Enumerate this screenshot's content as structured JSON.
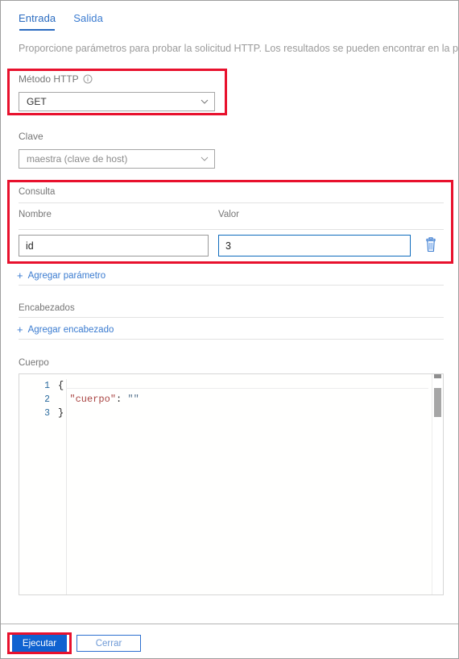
{
  "tabs": [
    {
      "label": "Entrada",
      "active": true
    },
    {
      "label": "Salida",
      "active": false
    }
  ],
  "description": "Proporcione parámetros para probar la solicitud HTTP. Los resultados se pueden encontrar en la pe",
  "method": {
    "label": "Método HTTP",
    "info_icon": "info-circle-icon",
    "value": "GET",
    "chevron_icon": "chevron-down-icon"
  },
  "key": {
    "label": "Clave",
    "value": "maestra (clave de host)",
    "chevron_icon": "chevron-down-icon"
  },
  "query": {
    "title": "Consulta",
    "columns": {
      "name": "Nombre",
      "value": "Valor"
    },
    "rows": [
      {
        "name": "id",
        "value": "3",
        "delete_icon": "trash-icon"
      }
    ],
    "add_label": "Agregar parámetro",
    "add_icon": "plus-icon"
  },
  "headers": {
    "title": "Encabezados",
    "add_label": "Agregar encabezado",
    "add_icon": "plus-icon"
  },
  "body": {
    "title": "Cuerpo",
    "lines": [
      {
        "number": "1",
        "open": "{",
        "key": "",
        "colon": "",
        "value": "",
        "close": ""
      },
      {
        "number": "2",
        "open": "",
        "key": "\"cuerpo\"",
        "colon": ":",
        "value": "\"\"",
        "close": ""
      },
      {
        "number": "3",
        "open": "",
        "key": "",
        "colon": "",
        "value": "",
        "close": "}"
      }
    ],
    "line_1_text": "{",
    "line_2_key": "\"cuerpo\"",
    "line_2_colon": ":",
    "line_2_value": "\"\"",
    "line_3_text": "}"
  },
  "footer": {
    "run_label": "Ejecutar",
    "close_label": "Cerrar"
  },
  "colors": {
    "accent_blue": "#0f62d0",
    "link_blue": "#3a7bd0",
    "highlight_red": "#e8112d",
    "label_gray": "#767676",
    "string_red": "#a94442",
    "gutter_blue": "#2b6b9e"
  }
}
